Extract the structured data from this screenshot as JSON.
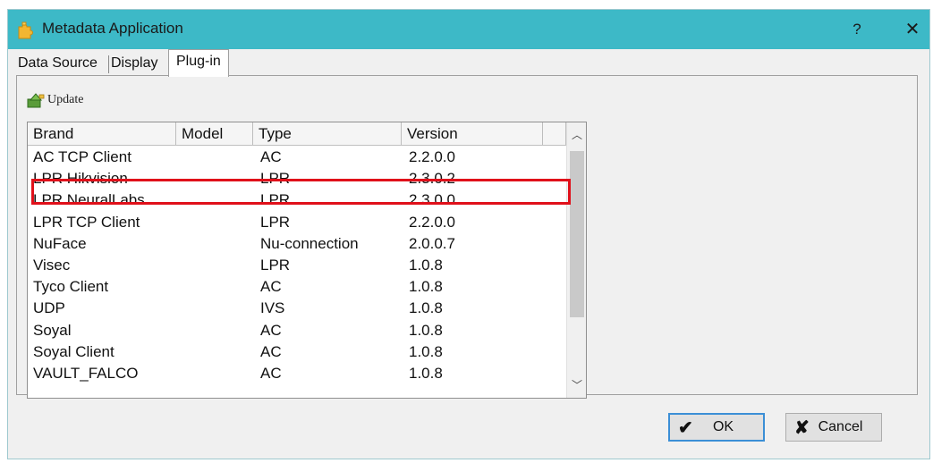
{
  "window": {
    "title": "Metadata Application",
    "help_label": "?",
    "close_label": "✕"
  },
  "tabs": [
    {
      "label": "Data Source"
    },
    {
      "label": "Display"
    },
    {
      "label": "Plug-in",
      "selected": true
    }
  ],
  "toolbar": {
    "update_label": "Update"
  },
  "list": {
    "columns": [
      "Brand",
      "Model",
      "Type",
      "Version"
    ],
    "rows": [
      {
        "brand": "AC TCP Client",
        "model": "",
        "type": "AC",
        "version": "2.2.0.0"
      },
      {
        "brand": "LPR Hikvision",
        "model": "",
        "type": "LPR",
        "version": "2.3.0.2",
        "highlighted": true
      },
      {
        "brand": "LPR NeuralLabs",
        "model": "",
        "type": "LPR",
        "version": "2.3.0.0"
      },
      {
        "brand": "LPR TCP Client",
        "model": "",
        "type": "LPR",
        "version": "2.2.0.0"
      },
      {
        "brand": "NuFace",
        "model": "",
        "type": "Nu-connection",
        "version": "2.0.0.7"
      },
      {
        "brand": "Visec",
        "model": "",
        "type": "LPR",
        "version": "1.0.8"
      },
      {
        "brand": "Tyco Client",
        "model": "",
        "type": "AC",
        "version": "1.0.8"
      },
      {
        "brand": "UDP",
        "model": "",
        "type": "IVS",
        "version": "1.0.8"
      },
      {
        "brand": "Soyal",
        "model": "",
        "type": "AC",
        "version": "1.0.8"
      },
      {
        "brand": "Soyal Client",
        "model": "",
        "type": "AC",
        "version": "1.0.8"
      },
      {
        "brand": "VAULT_FALCO",
        "model": "",
        "type": "AC",
        "version": "1.0.8"
      }
    ]
  },
  "buttons": {
    "ok_label": "OK",
    "ok_icon": "✔",
    "cancel_label": "Cancel",
    "cancel_icon": "✘"
  },
  "colors": {
    "titlebar": "#3db9c7",
    "highlight": "#e0101a",
    "default_button_border": "#3b8fd6"
  }
}
